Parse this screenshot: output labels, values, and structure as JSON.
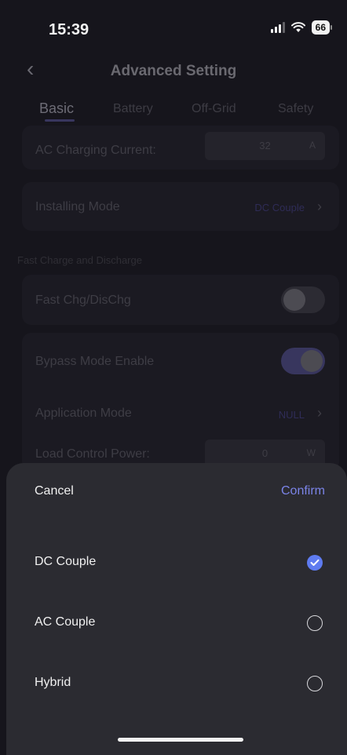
{
  "status": {
    "time": "15:39",
    "battery": "66"
  },
  "nav": {
    "title": "Advanced Setting"
  },
  "tabs": [
    {
      "label": "Basic"
    },
    {
      "label": "Battery"
    },
    {
      "label": "Off-Grid"
    },
    {
      "label": "Safety"
    }
  ],
  "settings": {
    "ac_charging_label": "AC Charging Current:",
    "ac_charging_value": "32",
    "ac_charging_unit": "A",
    "installing_mode_label": "Installing Mode",
    "installing_mode_value": "DC Couple",
    "fast_section_label": "Fast Charge and Discharge",
    "fast_chg_label": "Fast Chg/DisChg",
    "fast_chg_enabled": false,
    "bypass_label": "Bypass Mode Enable",
    "bypass_enabled": true,
    "application_mode_label": "Application Mode",
    "application_mode_value": "NULL",
    "load_control_label": "Load Control Power:",
    "load_control_value": "0",
    "load_control_unit": "W"
  },
  "sheet": {
    "cancel_label": "Cancel",
    "confirm_label": "Confirm",
    "options": [
      {
        "label": "DC Couple",
        "selected": true
      },
      {
        "label": "AC Couple",
        "selected": false
      },
      {
        "label": "Hybrid",
        "selected": false
      }
    ]
  },
  "colors": {
    "accent": "#7b84e8",
    "check": "#5e7bf0",
    "background": "#16151c",
    "sheet": "#2b2b31"
  }
}
